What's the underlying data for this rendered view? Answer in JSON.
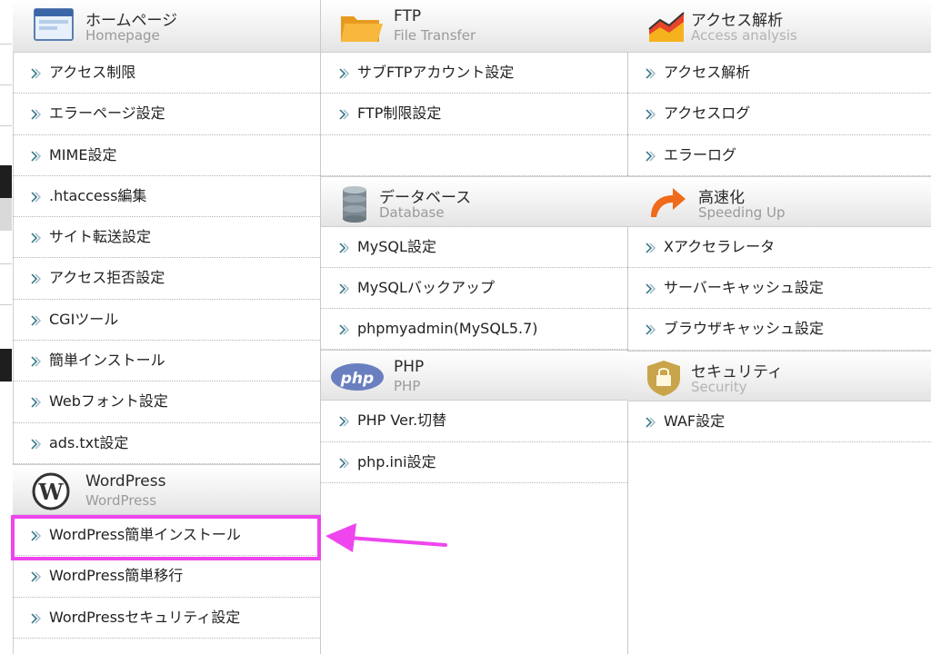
{
  "col1": {
    "homepage": {
      "title": "ホームページ",
      "subtitle": "Homepage",
      "items": [
        "アクセス制限",
        "エラーページ設定",
        "MIME設定",
        ".htaccess編集",
        "サイト転送設定",
        "アクセス拒否設定",
        "CGIツール",
        "簡単インストール",
        "Webフォント設定",
        "ads.txt設定"
      ]
    },
    "wordpress": {
      "title": "WordPress",
      "subtitle": "WordPress",
      "items": [
        "WordPress簡単インストール",
        "WordPress簡単移行",
        "WordPressセキュリティ設定"
      ]
    }
  },
  "col2": {
    "ftp": {
      "title": "FTP",
      "subtitle": "File Transfer",
      "items": [
        "サブFTPアカウント設定",
        "FTP制限設定"
      ]
    },
    "database": {
      "title": "データベース",
      "subtitle": "Database",
      "items": [
        "MySQL設定",
        "MySQLバックアップ",
        "phpmyadmin(MySQL5.7)"
      ]
    },
    "php": {
      "title": "PHP",
      "subtitle": "PHP",
      "icon_text": "php",
      "items": [
        "PHP Ver.切替",
        "php.ini設定"
      ]
    }
  },
  "col3": {
    "access": {
      "title": "アクセス解析",
      "subtitle": "Access analysis",
      "items": [
        "アクセス解析",
        "アクセスログ",
        "エラーログ"
      ]
    },
    "speed": {
      "title": "高速化",
      "subtitle": "Speeding Up",
      "items": [
        "Xアクセラレータ",
        "サーバーキャッシュ設定",
        "ブラウザキャッシュ設定"
      ]
    },
    "security": {
      "title": "セキュリティ",
      "subtitle": "Security",
      "items": [
        "WAF設定"
      ]
    }
  },
  "colors": {
    "highlight": "#ee45ee",
    "arrow_icon": "#2a6f86"
  }
}
